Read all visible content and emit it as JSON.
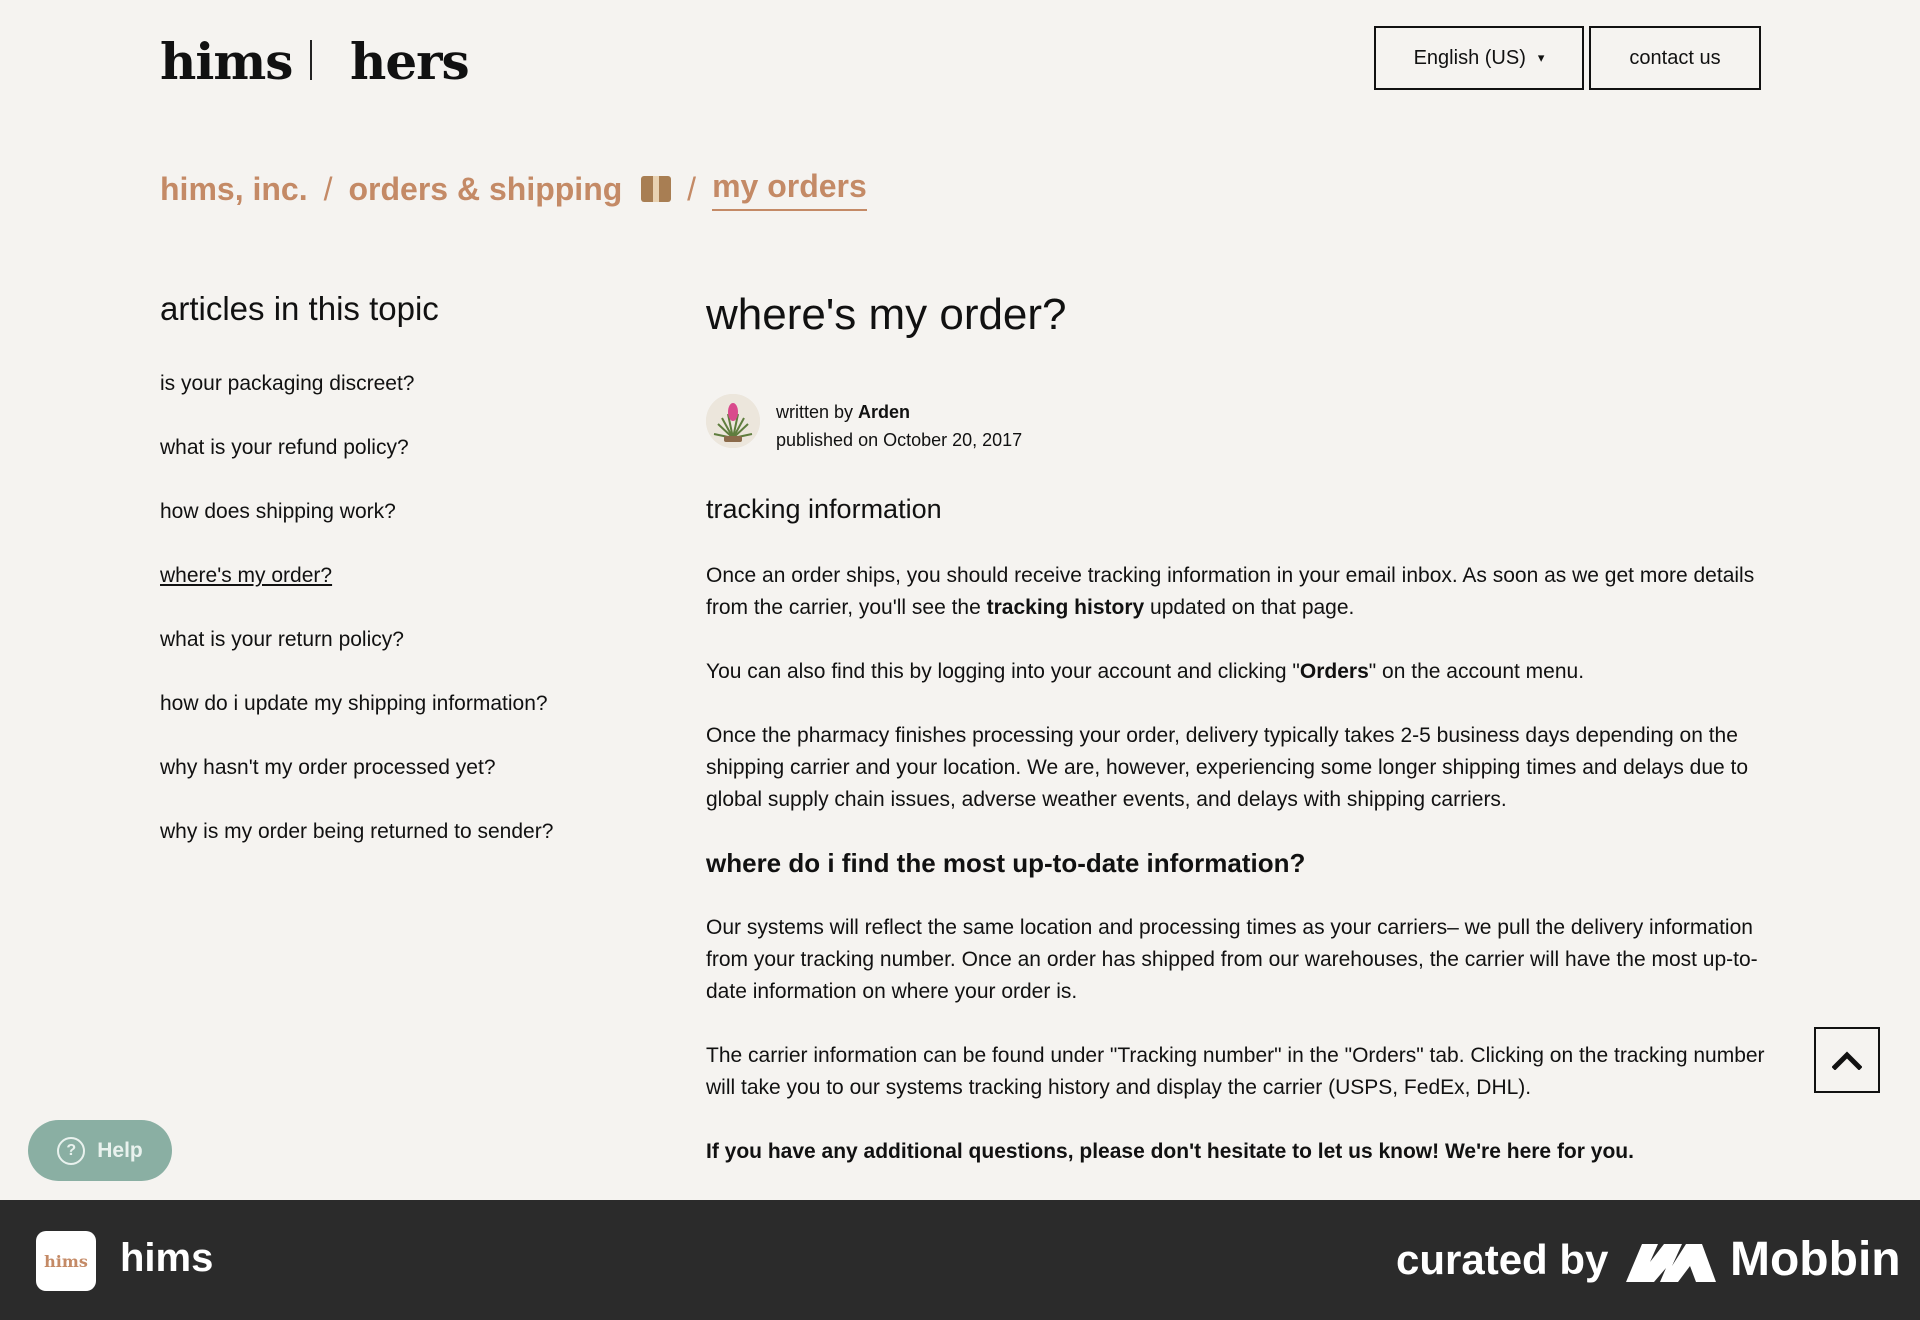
{
  "header": {
    "logo_left": "hims",
    "logo_right": "hers",
    "language_label": "English (US)",
    "contact_label": "contact us"
  },
  "breadcrumb": {
    "items": [
      "hims, inc.",
      "orders & shipping",
      "my orders"
    ],
    "separator": "/"
  },
  "sidebar": {
    "title": "articles in this topic",
    "items": [
      {
        "label": "is your packaging discreet?"
      },
      {
        "label": "what is your refund policy?"
      },
      {
        "label": "how does shipping work?"
      },
      {
        "label": "where's my order?",
        "active": true
      },
      {
        "label": "what is your return policy?"
      },
      {
        "label": "how do i update my shipping information?"
      },
      {
        "label": "why hasn't my order processed yet?"
      },
      {
        "label": "why is my order being returned to sender?"
      }
    ]
  },
  "article": {
    "title": "where's my order?",
    "written_by_prefix": "written by",
    "author": "Arden",
    "published_on": "published on October 20, 2017",
    "section1_title": "tracking information",
    "p1_a": "Once an order ships, you should receive tracking information in your email inbox. As soon as we get more details from the carrier, you'll see the ",
    "p1_bold": "tracking history",
    "p1_b": " updated on that page.",
    "p2_a": "You can also find this by logging into your account and clicking \"",
    "p2_bold": "Orders",
    "p2_b": "\" on the account menu.",
    "p3": "Once the pharmacy finishes processing your order, delivery typically takes 2-5 business days depending on the shipping carrier and your location. We are, however, experiencing some longer shipping times and delays due to global supply chain issues, adverse weather events, and delays with shipping carriers.",
    "section2_title": "where do i find the most up-to-date information?",
    "p4": "Our systems will reflect the same location and processing times as your carriers– we pull the delivery information from your tracking number. Once an order has shipped from our warehouses, the carrier will have the most up-to-date information on where your order is.",
    "p5": "The carrier information can be found under \"Tracking number\" in the \"Orders\" tab. Clicking on the tracking number will take you to our systems tracking history and display the carrier (USPS, FedEx, DHL).",
    "p6": "If you have any additional questions, please don't hesitate to let us know! We're here for you."
  },
  "help": {
    "label": "Help"
  },
  "footer": {
    "app_icon_text": "hims",
    "app_name": "hims",
    "curated_by": "curated by",
    "brand": "Mobbin"
  },
  "colors": {
    "background": "#f5f3f0",
    "accent": "#c48a66",
    "help": "#8aafa3",
    "footer": "#2b2b2b"
  }
}
